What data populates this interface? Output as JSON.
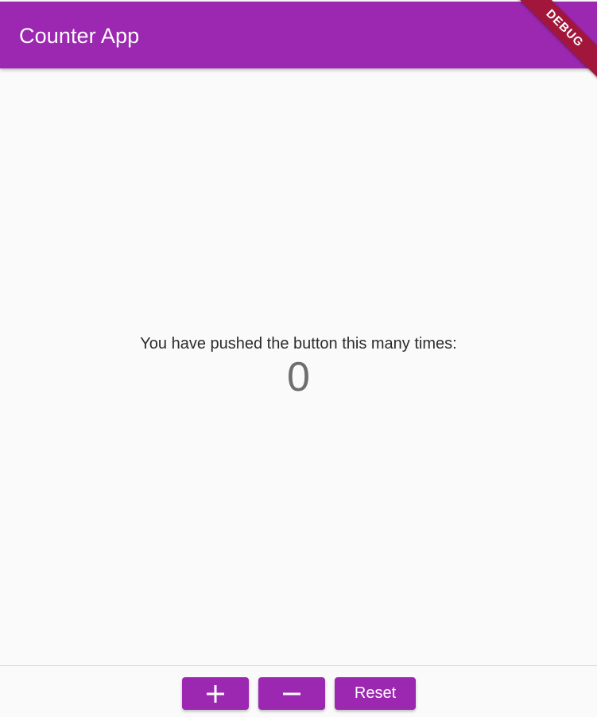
{
  "app_bar": {
    "title": "Counter App",
    "color": "#9c27b0"
  },
  "debug_banner": {
    "label": "DEBUG",
    "color": "#a1163a"
  },
  "main": {
    "prompt": "You have pushed the button this many times:",
    "counter_value": "0"
  },
  "bottom_bar": {
    "buttons": [
      {
        "icon": "plus-icon"
      },
      {
        "icon": "minus-icon"
      },
      {
        "label": "Reset"
      }
    ]
  }
}
